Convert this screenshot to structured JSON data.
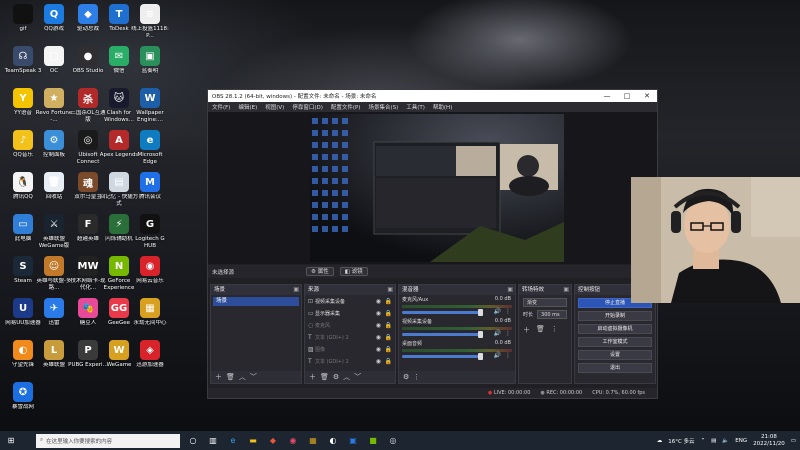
{
  "desktop": {
    "icons": [
      {
        "label": "gif",
        "color": "#111111",
        "glyph": ""
      },
      {
        "label": "QQ游戏",
        "color": "#1c7be0",
        "glyph": "Q"
      },
      {
        "label": "驱动总裁",
        "color": "#2e7ee8",
        "glyph": "◆"
      },
      {
        "label": "ToDesk",
        "color": "#1f6fd1",
        "glyph": "T"
      },
      {
        "label": "线上投篮1118: P...",
        "color": "#eeeeee",
        "glyph": "≡"
      },
      {
        "label": "TeamSpeak 3",
        "color": "#3a4a6a",
        "glyph": "☊"
      },
      {
        "label": "OC",
        "color": "#f4f4f4",
        "glyph": "□"
      },
      {
        "label": "OBS Studio",
        "color": "#302e31",
        "glyph": "●"
      },
      {
        "label": "微信",
        "color": "#2aae67",
        "glyph": "✉"
      },
      {
        "label": "蓝奏明",
        "color": "#2a8f5a",
        "glyph": "▣"
      },
      {
        "label": "YY语音",
        "color": "#f5c400",
        "glyph": "Y"
      },
      {
        "label": "Revo Fortune -...",
        "color": "#d0b060",
        "glyph": "★"
      },
      {
        "label": "三国杀OL互通版",
        "color": "#b02a2a",
        "glyph": "杀"
      },
      {
        "label": "Clash for Windows...",
        "color": "#1a1a2e",
        "glyph": "🐱"
      },
      {
        "label": "Wallpaper Engine:...",
        "color": "#1c5fa8",
        "glyph": "W"
      },
      {
        "label": "QQ音乐",
        "color": "#f2c21b",
        "glyph": "♪"
      },
      {
        "label": "控制面板",
        "color": "#3b8ed8",
        "glyph": "⚙"
      },
      {
        "label": "Ubisoft Connect",
        "color": "#1a1a1a",
        "glyph": "◎"
      },
      {
        "label": "Apex Legends",
        "color": "#b42a2a",
        "glyph": "A"
      },
      {
        "label": "Microsoft Edge",
        "color": "#0f7bc0",
        "glyph": "e"
      },
      {
        "label": "腾讯QQ",
        "color": "#f5f5f5",
        "glyph": "🐧"
      },
      {
        "label": "回收站",
        "color": "#e8eef5",
        "glyph": "🗑"
      },
      {
        "label": "双尔马皇主",
        "color": "#7a4a2a",
        "glyph": "魂"
      },
      {
        "label": "回记忆 - 快捷方式",
        "color": "#cfd8e0",
        "glyph": "▤"
      },
      {
        "label": "腾讯会议",
        "color": "#1e6fe8",
        "glyph": "M"
      },
      {
        "label": "此电脑",
        "color": "#2f7fd8",
        "glyph": "▭"
      },
      {
        "label": "英雄联盟WeGame版",
        "color": "#1a2430",
        "glyph": "⚔"
      },
      {
        "label": "超越英雄",
        "color": "#2a2a2a",
        "glyph": "F"
      },
      {
        "label": "闪烁辅助机",
        "color": "#2a6e3a",
        "glyph": "⚡"
      },
      {
        "label": "Logitech G HUB",
        "color": "#111111",
        "glyph": "G"
      },
      {
        "label": "Steam",
        "color": "#1b2838",
        "glyph": "S"
      },
      {
        "label": "英雄与联盟-多路...",
        "color": "#c27a2a",
        "glyph": "☺"
      },
      {
        "label": "技术网络卡-现代化...",
        "color": "#222222",
        "glyph": "MW"
      },
      {
        "label": "GeForce Experience",
        "color": "#76b900",
        "glyph": "N"
      },
      {
        "label": "网易云音乐",
        "color": "#d8232a",
        "glyph": "◉"
      },
      {
        "label": "网易UU加速器",
        "color": "#1d3a8a",
        "glyph": "U"
      },
      {
        "label": "迅雷",
        "color": "#2a7ae8",
        "glyph": "✈"
      },
      {
        "label": "糖豆人",
        "color": "#e84a9a",
        "glyph": "🎭"
      },
      {
        "label": "GeeGee",
        "color": "#e83a4a",
        "glyph": "GG"
      },
      {
        "label": "永劫无间中心",
        "color": "#d8a020",
        "glyph": "▦"
      },
      {
        "label": "守望先锋",
        "color": "#f08a1a",
        "glyph": "◐"
      },
      {
        "label": "英雄联盟",
        "color": "#c89b3c",
        "glyph": "L"
      },
      {
        "label": "PUBG Experi...",
        "color": "#3a3a3a",
        "glyph": "P"
      },
      {
        "label": "WeGame",
        "color": "#d8a020",
        "glyph": "W"
      },
      {
        "label": "迅游加速器",
        "color": "#d8232a",
        "glyph": "◈"
      },
      {
        "label": "暴雪战网",
        "color": "#1b6fe0",
        "glyph": "✪"
      }
    ]
  },
  "obs": {
    "title": "OBS 28.1.2 (64-bit, windows) - 配置文件: 未命名 - 场景: 未命名",
    "window_controls": {
      "minimize": "—",
      "maximize": "□",
      "close": "✕"
    },
    "menu": [
      "文件(F)",
      "编辑(E)",
      "视图(V)",
      "停靠窗口(D)",
      "配置文件(P)",
      "场景集合(S)",
      "工具(T)",
      "帮助(H)"
    ],
    "source_toolbar": {
      "label": "未选择源",
      "properties": "⚙ 属性",
      "filters": "◧ 滤镜"
    },
    "scenes": {
      "title": "场景",
      "items": [
        "场景"
      ]
    },
    "sources": {
      "title": "来源",
      "items": [
        {
          "name": "视频采集设备",
          "icon": "⊡",
          "active": true
        },
        {
          "name": "显示器采集",
          "icon": "▭",
          "active": true
        },
        {
          "name": "麦克风",
          "icon": "◌",
          "active": false
        },
        {
          "name": "文本 (GDI+) 2",
          "icon": "T",
          "active": false
        },
        {
          "name": "图像",
          "icon": "▨",
          "active": false
        },
        {
          "name": "文本 (GDI+) 2",
          "icon": "T",
          "active": false
        }
      ]
    },
    "mixer": {
      "title": "混音器",
      "channels": [
        {
          "name": "麦克风/Aux",
          "db": "0.0 dB"
        },
        {
          "name": "视频采集设备",
          "db": "0.0 dB"
        },
        {
          "name": "桌面音频",
          "db": "0.0 dB"
        }
      ]
    },
    "transitions": {
      "title": "转场特效",
      "selected": "渐变",
      "duration_label": "时长",
      "duration": "300 ms"
    },
    "controls": {
      "title": "控制按钮",
      "buttons": [
        "停止直播",
        "开始录制",
        "启动虚拟摄像机",
        "工作室模式",
        "设置",
        "退出"
      ]
    },
    "status": {
      "live": "LIVE: 00:00:00",
      "rec": "REC: 00:00:00",
      "cpu": "CPU: 0.7%, 60.00 fps"
    }
  },
  "taskbar": {
    "search_placeholder": "在这里输入你要搜索的内容",
    "weather": "16°C 多云",
    "lang": "ENG",
    "time": "21:08",
    "date": "2022/11/20"
  }
}
